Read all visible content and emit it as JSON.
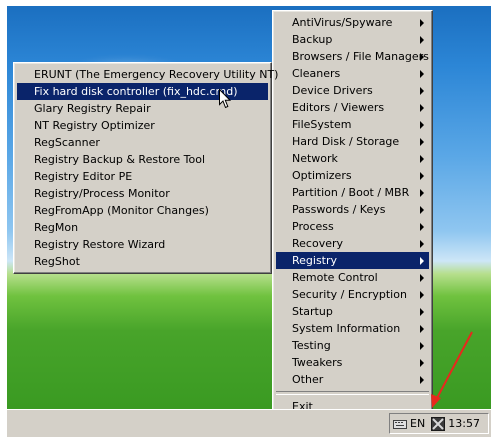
{
  "colors": {
    "menu_bg": "#d4d0c8",
    "highlight_bg": "#0a246a",
    "highlight_text": "#ffffff",
    "annotation_arrow": "#e8281d"
  },
  "main_menu": {
    "items": [
      {
        "label": "AntiVirus/Spyware",
        "submenu": true
      },
      {
        "label": "Backup",
        "submenu": true
      },
      {
        "label": "Browsers / File Managers",
        "submenu": true
      },
      {
        "label": "Cleaners",
        "submenu": true
      },
      {
        "label": "Device Drivers",
        "submenu": true
      },
      {
        "label": "Editors / Viewers",
        "submenu": true
      },
      {
        "label": "FileSystem",
        "submenu": true
      },
      {
        "label": "Hard Disk / Storage",
        "submenu": true
      },
      {
        "label": "Network",
        "submenu": true
      },
      {
        "label": "Optimizers",
        "submenu": true
      },
      {
        "label": "Partition / Boot / MBR",
        "submenu": true
      },
      {
        "label": "Passwords / Keys",
        "submenu": true
      },
      {
        "label": "Process",
        "submenu": true
      },
      {
        "label": "Recovery",
        "submenu": true
      },
      {
        "label": "Registry",
        "submenu": true,
        "highlighted": true
      },
      {
        "label": "Remote Control",
        "submenu": true
      },
      {
        "label": "Security / Encryption",
        "submenu": true
      },
      {
        "label": "Startup",
        "submenu": true
      },
      {
        "label": "System Information",
        "submenu": true
      },
      {
        "label": "Testing",
        "submenu": true
      },
      {
        "label": "Tweakers",
        "submenu": true
      },
      {
        "label": "Other",
        "submenu": true
      }
    ],
    "exit_label": "Exit"
  },
  "registry_submenu": {
    "items": [
      {
        "label": "ERUNT (The Emergency Recovery Utility NT)"
      },
      {
        "label": "Fix hard disk controller (fix_hdc.cmd)",
        "highlighted": true
      },
      {
        "label": "Glary Registry Repair"
      },
      {
        "label": "NT Registry Optimizer"
      },
      {
        "label": "RegScanner"
      },
      {
        "label": "Registry Backup & Restore Tool"
      },
      {
        "label": "Registry Editor PE"
      },
      {
        "label": "Registry/Process Monitor"
      },
      {
        "label": "RegFromApp (Monitor Changes)"
      },
      {
        "label": "RegMon"
      },
      {
        "label": "Registry Restore Wizard"
      },
      {
        "label": "RegShot"
      }
    ]
  },
  "taskbar": {
    "tray": {
      "keyboard_icon": "keyboard-icon",
      "language": "EN",
      "tool_icon": "tools-tray-icon",
      "clock": "13:57"
    }
  }
}
